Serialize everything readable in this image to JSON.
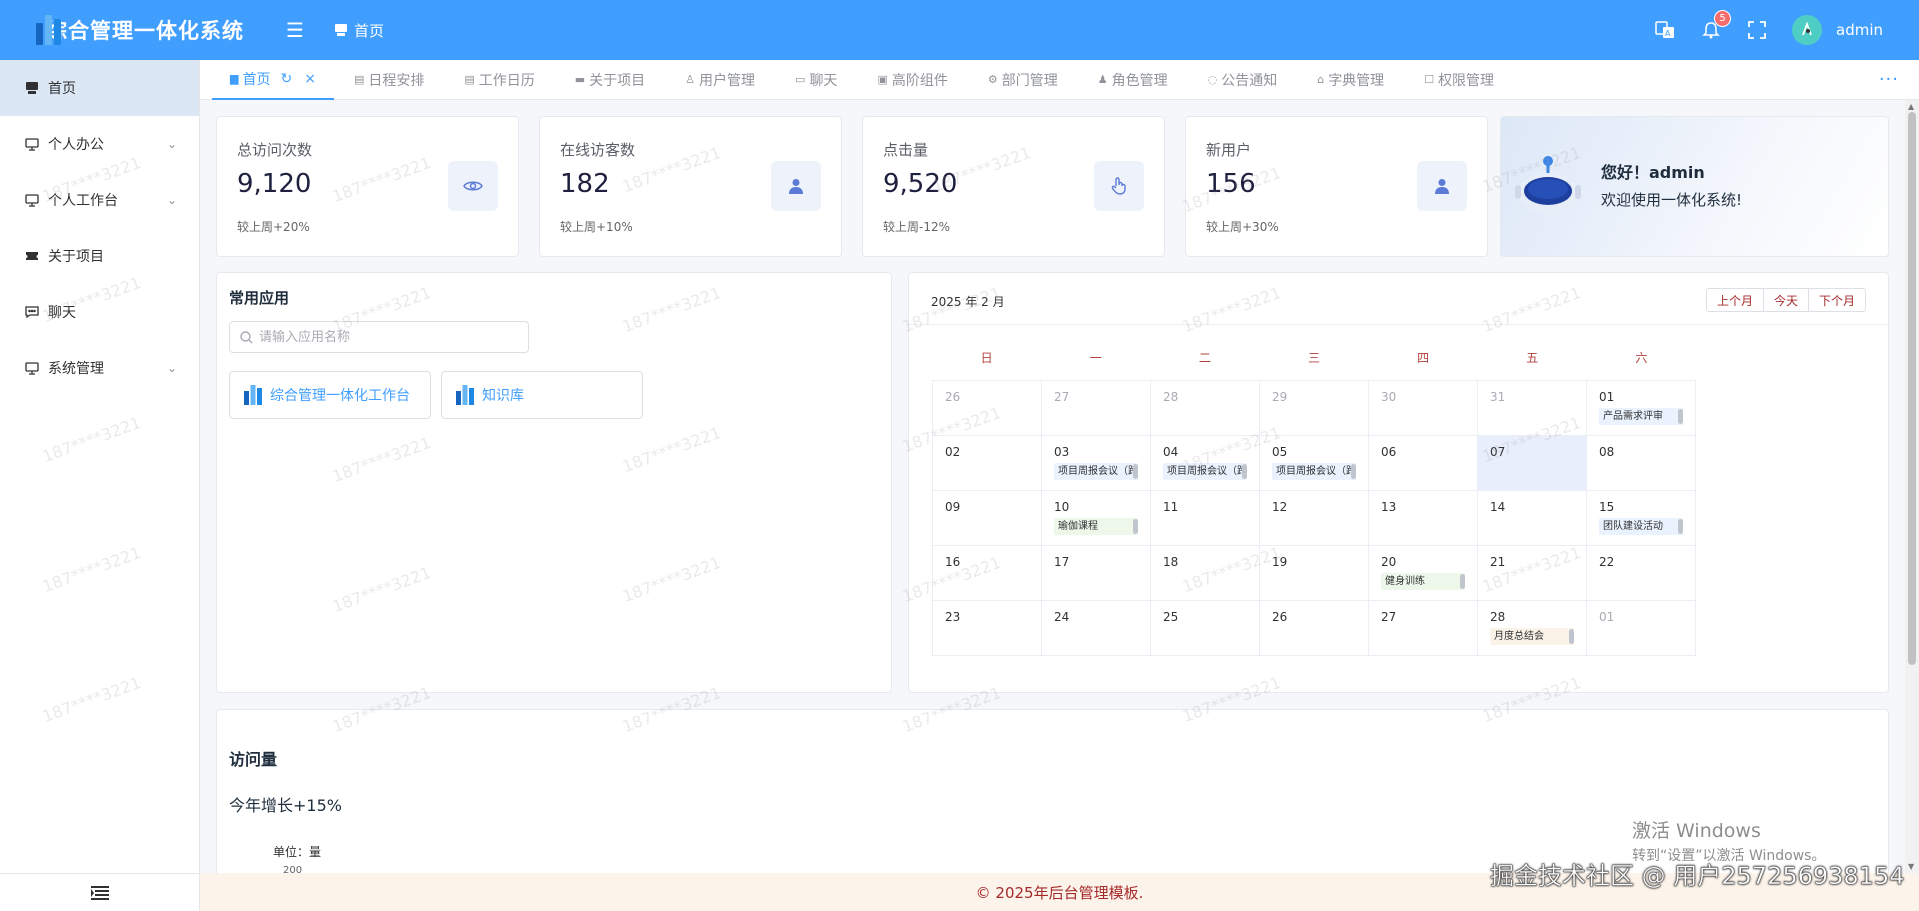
{
  "app": {
    "title": "综合管理一体化系统",
    "breadcrumb": "首页",
    "notification_count": "5",
    "username": "admin"
  },
  "colors": {
    "primary": "#409eff",
    "sidebar_active": "#dbe7f5",
    "footer_bg": "#fcf3ea",
    "footer_text": "#a52a2a"
  },
  "sidebar": {
    "items": [
      {
        "label": "首页",
        "icon": "home-icon",
        "active": true
      },
      {
        "label": "个人办公",
        "icon": "monitor-icon",
        "expandable": true
      },
      {
        "label": "个人工作台",
        "icon": "monitor-icon",
        "expandable": true
      },
      {
        "label": "关于项目",
        "icon": "ticket-icon"
      },
      {
        "label": "聊天",
        "icon": "chat-icon"
      },
      {
        "label": "系统管理",
        "icon": "monitor-icon",
        "expandable": true
      }
    ]
  },
  "tabs": [
    {
      "label": "首页",
      "active": true
    },
    {
      "label": "日程安排"
    },
    {
      "label": "工作日历"
    },
    {
      "label": "关于项目"
    },
    {
      "label": "用户管理"
    },
    {
      "label": "聊天"
    },
    {
      "label": "高阶组件"
    },
    {
      "label": "部门管理"
    },
    {
      "label": "角色管理"
    },
    {
      "label": "公告通知"
    },
    {
      "label": "字典管理"
    },
    {
      "label": "权限管理"
    }
  ],
  "stats": [
    {
      "label": "总访问次数",
      "value": "9,120",
      "sub": "较上周+20%",
      "icon": "eye-icon"
    },
    {
      "label": "在线访客数",
      "value": "182",
      "sub": "较上周+10%",
      "icon": "user-icon"
    },
    {
      "label": "点击量",
      "value": "9,520",
      "sub": "较上周-12%",
      "icon": "pointer-icon"
    },
    {
      "label": "新用户",
      "value": "156",
      "sub": "较上周+30%",
      "icon": "user-icon"
    }
  ],
  "welcome": {
    "title": "您好！admin",
    "subtitle": "欢迎使用一体化系统!"
  },
  "apps": {
    "title": "常用应用",
    "search_placeholder": "请输入应用名称",
    "items": [
      {
        "label": "综合管理一体化工作台"
      },
      {
        "label": "知识库"
      }
    ]
  },
  "calendar": {
    "title": "2025 年 2 月",
    "buttons": {
      "prev": "上个月",
      "today": "今天",
      "next": "下个月"
    },
    "weekdays": [
      "日",
      "一",
      "二",
      "三",
      "四",
      "五",
      "六"
    ],
    "weeks": [
      [
        {
          "d": "26",
          "other": true
        },
        {
          "d": "27",
          "other": true
        },
        {
          "d": "28",
          "other": true
        },
        {
          "d": "29",
          "other": true
        },
        {
          "d": "30",
          "other": true
        },
        {
          "d": "31",
          "other": true
        },
        {
          "d": "01",
          "event": "产品需求评审",
          "color": "#e9f2fd"
        }
      ],
      [
        {
          "d": "02"
        },
        {
          "d": "03",
          "event": "项目周报会议（跨日期）",
          "color": "#e9f2fd"
        },
        {
          "d": "04",
          "event": "项目周报会议（跨日期）",
          "color": "#e9f2fd"
        },
        {
          "d": "05",
          "event": "项目周报会议（跨日期）",
          "color": "#e9f2fd"
        },
        {
          "d": "06"
        },
        {
          "d": "07",
          "today": true
        },
        {
          "d": "08"
        }
      ],
      [
        {
          "d": "09"
        },
        {
          "d": "10",
          "event": "瑜伽课程",
          "color": "#edf7ea"
        },
        {
          "d": "11"
        },
        {
          "d": "12"
        },
        {
          "d": "13"
        },
        {
          "d": "14"
        },
        {
          "d": "15",
          "event": "团队建设活动",
          "color": "#e9f2fd"
        }
      ],
      [
        {
          "d": "16"
        },
        {
          "d": "17"
        },
        {
          "d": "18"
        },
        {
          "d": "19"
        },
        {
          "d": "20",
          "event": "健身训练",
          "color": "#edf7ea"
        },
        {
          "d": "21"
        },
        {
          "d": "22"
        }
      ],
      [
        {
          "d": "23"
        },
        {
          "d": "24"
        },
        {
          "d": "25"
        },
        {
          "d": "26"
        },
        {
          "d": "27"
        },
        {
          "d": "28",
          "event": "月度总结会",
          "color": "#fbf3e8"
        },
        {
          "d": "01",
          "other": true
        }
      ]
    ]
  },
  "visits": {
    "title": "访问量",
    "growth": "今年增长+15%",
    "unit": "单位：量",
    "first_tick": "200"
  },
  "footer": {
    "text": "© 2025年后台管理模板."
  },
  "overlay": {
    "windows_activate_line1": "激活 Windows",
    "windows_activate_line2": "转到“设置”以激活 Windows。",
    "juejin": "掘金技术社区 @ 用户2572569381​54",
    "watermark": "187****3221"
  }
}
